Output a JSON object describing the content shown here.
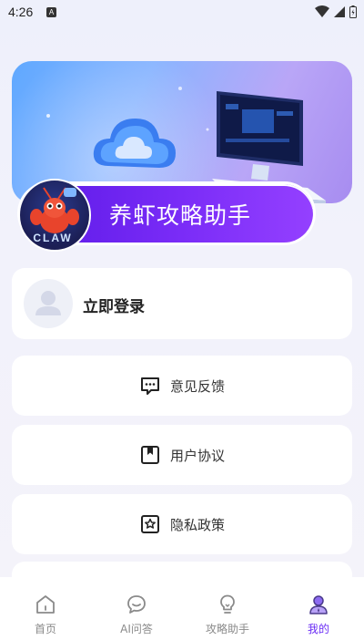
{
  "status_bar": {
    "time": "4:26",
    "notification_badge": "A"
  },
  "banner": {
    "title": "养虾攻略助手",
    "logo_text": "CLAW"
  },
  "login": {
    "label": "立即登录"
  },
  "menu": [
    {
      "label": "意见反馈",
      "icon": "chat-dots-icon"
    },
    {
      "label": "用户协议",
      "icon": "bookmark-icon"
    },
    {
      "label": "隐私政策",
      "icon": "star-badge-icon"
    }
  ],
  "tabs": [
    {
      "label": "首页",
      "icon": "home-icon",
      "active": false
    },
    {
      "label": "AI问答",
      "icon": "chat-bubble-icon",
      "active": false
    },
    {
      "label": "攻略助手",
      "icon": "lightbulb-icon",
      "active": false
    },
    {
      "label": "我的",
      "icon": "user-icon",
      "active": true
    }
  ],
  "colors": {
    "accent": "#6a2cf5",
    "inactive": "#8a8a8a"
  }
}
